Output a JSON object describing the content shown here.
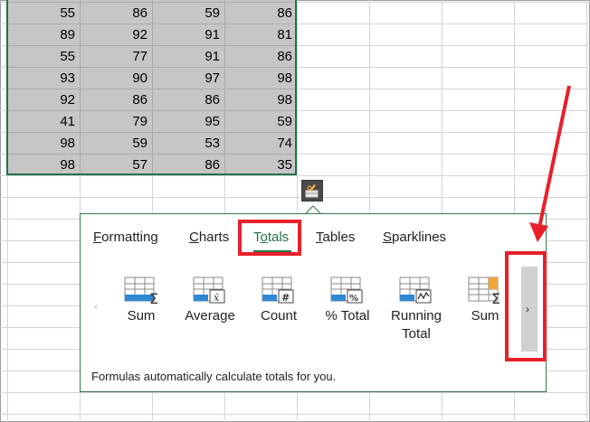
{
  "sheet": {
    "rows": [
      [
        55,
        86,
        59,
        86
      ],
      [
        89,
        92,
        91,
        81
      ],
      [
        55,
        77,
        91,
        86
      ],
      [
        93,
        90,
        97,
        98
      ],
      [
        92,
        86,
        86,
        98
      ],
      [
        41,
        79,
        95,
        59
      ],
      [
        98,
        59,
        53,
        74
      ],
      [
        98,
        57,
        86,
        35
      ]
    ]
  },
  "quick_analysis": {
    "tabs": [
      {
        "pre": "",
        "acc": "F",
        "post": "ormatting"
      },
      {
        "pre": "",
        "acc": "C",
        "post": "harts"
      },
      {
        "pre": "T",
        "acc": "o",
        "post": "tals"
      },
      {
        "pre": "",
        "acc": "T",
        "post": "ables"
      },
      {
        "pre": "",
        "acc": "S",
        "post": "parklines"
      }
    ],
    "active_tab": "Totals",
    "items": [
      {
        "label": "Sum",
        "icon": "sum-icon"
      },
      {
        "label": "Average",
        "icon": "average-icon"
      },
      {
        "label": "Count",
        "icon": "count-icon"
      },
      {
        "label": "% Total",
        "icon": "percent-total-icon"
      },
      {
        "label": "Running Total",
        "icon": "running-total-icon"
      },
      {
        "label": "Sum",
        "icon": "sum-right-icon"
      }
    ],
    "description": "Formulas automatically calculate totals for you.",
    "scroll_left": "‹",
    "scroll_right": "›"
  },
  "colors": {
    "accent": "#217346",
    "highlight": "#e8202a",
    "selection": "#c6c6c6",
    "icon_blue": "#2e88d6",
    "icon_orange": "#f2a43a"
  }
}
